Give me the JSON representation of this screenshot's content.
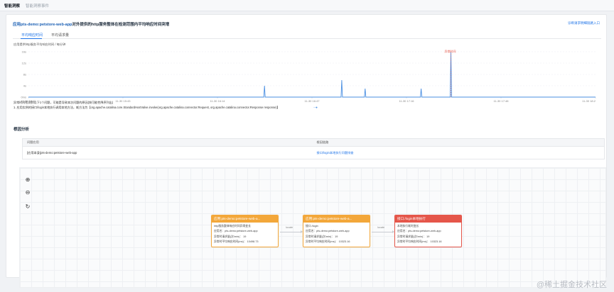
{
  "top_tabs": [
    {
      "label": "智能洞察"
    },
    {
      "label": "智能洞察事件"
    }
  ],
  "card": {
    "title_app": "应用pts-demo:petstore-web-app",
    "title_rest": "对外提供的http服务整体在检测范围内平均响应时间突增",
    "link": "诊断请求明细链路入口"
  },
  "sub_tabs": [
    {
      "label": "平均响应时间"
    },
    {
      "label": "平均请求量"
    }
  ],
  "chart_caption": "应用提供http服务平均响应时间 / 每分钟",
  "chart_data": {
    "type": "line",
    "title": "",
    "ylabel": "",
    "xlabel": "",
    "yticks": [
      "16s",
      "12s",
      "8s",
      "4s",
      "0ms"
    ],
    "xticks": [
      "11-30 15:15",
      "11-30 15:43",
      "11-30 16:14",
      "11-30 16:47",
      "11-30 17:16",
      "11-30 17:48",
      "11-30 18:2"
    ],
    "ylim": [
      0,
      16
    ],
    "x": [
      0,
      332,
      333,
      334,
      441,
      442,
      443,
      474,
      475,
      476,
      553,
      554,
      555,
      595,
      596,
      597,
      800
    ],
    "series": [
      {
        "name": "",
        "color": "#4a8fe2",
        "values": [
          0,
          0,
          4,
          0,
          0,
          6,
          0,
          0,
          3,
          0,
          0,
          3,
          0,
          0,
          16,
          0,
          0
        ]
      }
    ],
    "annotation": {
      "label": "异常时间",
      "color": "#e5564a"
    },
    "legend": {
      "label": "--●",
      "position": "bottom-center"
    },
    "grid": true
  },
  "result_lines": [
    "异常时间检测到以下1个问题，可能是导致本次问题的原因(按可能性降序列出)",
    "1. 应用实例的接口/login本地执行调用本地方法，耗方法为【org.apache.catalina.core.StandardHostValve.invoke(org.apache.catalina.connector.Request, org.apache.catalina.connector.Response response)】"
  ],
  "section": {
    "title": "根因分析"
  },
  "table": {
    "headers": [
      "问题应用",
      "根因链路"
    ],
    "rows": [
      {
        "app": "[应用本身]pts-demo:petstore-web-app",
        "cause": "接口/login本地执行问题排查"
      }
    ]
  },
  "topology": {
    "nodes": [
      {
        "title": "应用:pts-demo:petstore-web-a...",
        "status": "orange",
        "lines": [
          "http服务整体响应时间异常变长",
          "应用名：pts-demo:petstore-web-app",
          "异常时请求量(次/min)：  19",
          "异常时平均响应时间(ms)：  10498.73"
        ]
      },
      {
        "title": "应用:pts-demo:petstore-web-a...",
        "status": "orange",
        "lines": [
          "接口:/login",
          "应用名：pts-demo:petstore-web-app",
          "异常时请求量(次/min)：  19",
          "异常时平均响应时间(ms)：  10323.16"
        ]
      },
      {
        "title": "接口:/login本地执行",
        "status": "red",
        "lines": [
          "本地执行耗时变长",
          "应用名：pts-demo:petstore-web-app",
          "异常时请求量(次/min)：  19",
          "异常时平均响应时间(ms)：  10323.16"
        ]
      }
    ],
    "edges": [
      {
        "label": "locate"
      },
      {
        "label": "locate"
      }
    ],
    "controls": [
      {
        "icon": "zoom-in-icon",
        "glyph": "⊕"
      },
      {
        "icon": "zoom-out-icon",
        "glyph": "⊖"
      },
      {
        "icon": "reset-icon",
        "glyph": "↻"
      }
    ]
  },
  "watermark": "@稀土掘金技术社区"
}
